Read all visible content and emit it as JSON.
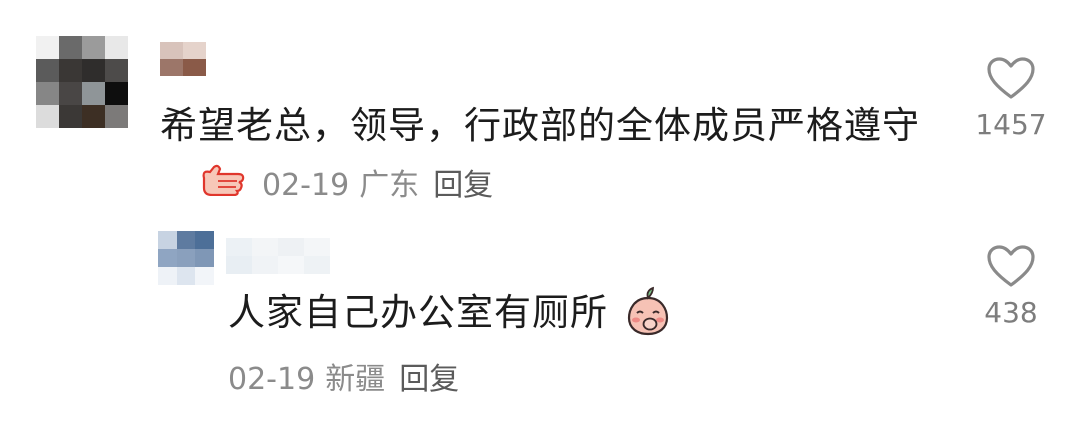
{
  "comments": [
    {
      "avatar_icon": "pixelated-avatar",
      "username_icon": "pixelated-username",
      "text": "希望老总，领导，行政部的全体成员严格遵守",
      "emoji_icon": "thumbs-up-emoji",
      "date": "02-19",
      "location": "广东",
      "reply_label": "回复",
      "like_icon": "heart-outline-icon",
      "like_count": "1457"
    },
    {
      "avatar_icon": "pixelated-avatar",
      "username_icon": "pixelated-username",
      "text": "人家自己办公室有厕所",
      "emoji_icon": "giggling-peach-emoji",
      "date": "02-19",
      "location": "新疆",
      "reply_label": "回复",
      "like_icon": "heart-outline-icon",
      "like_count": "438"
    }
  ],
  "colors": {
    "text": "#1c1c1c",
    "meta": "#8b8b8b",
    "reply": "#5b5b5b",
    "count": "#7d7d7d"
  }
}
